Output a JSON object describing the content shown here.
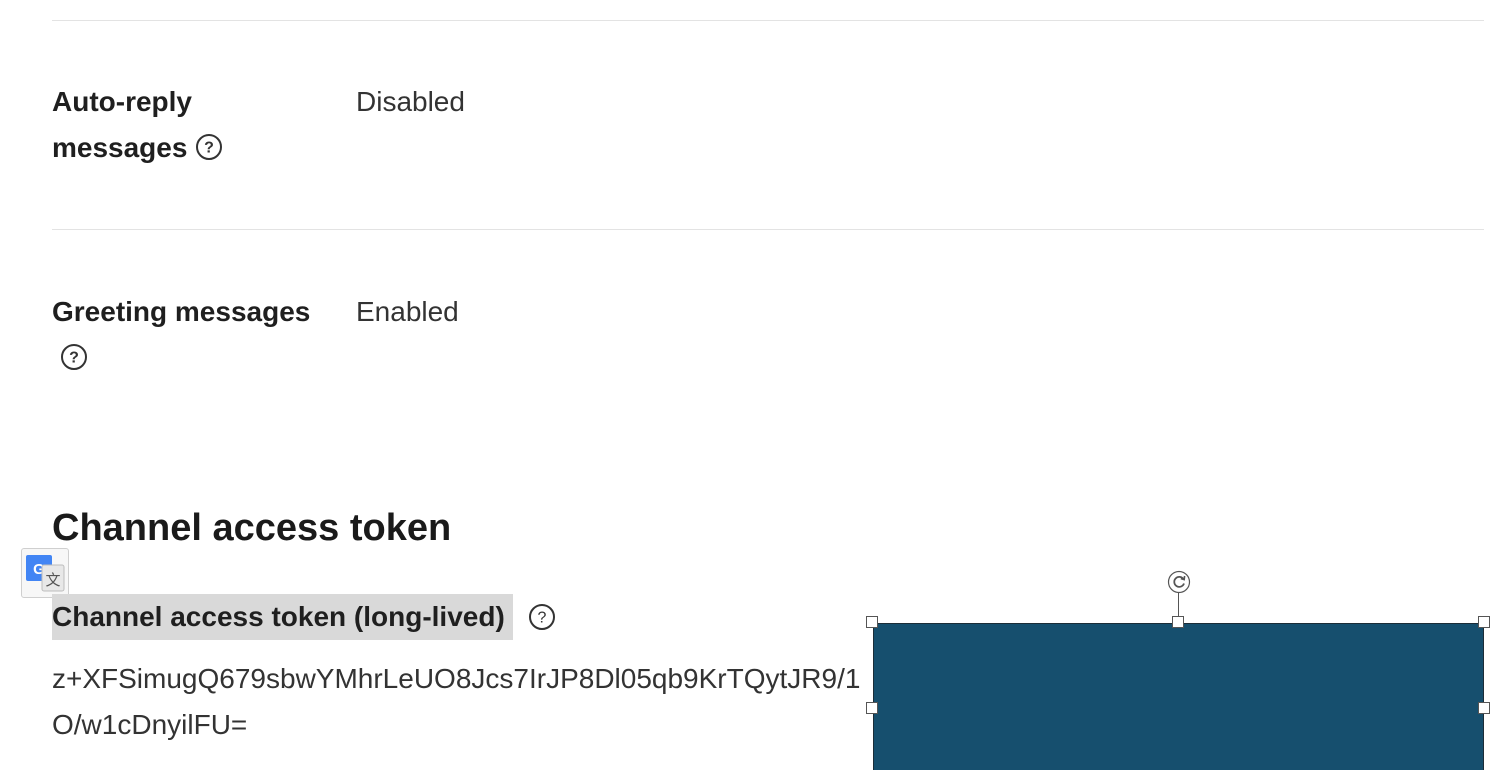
{
  "settings": {
    "auto_reply": {
      "label": "Auto-reply messages",
      "value": "Disabled",
      "help_icon": "help-circle-icon"
    },
    "greeting": {
      "label": "Greeting messages",
      "value": "Enabled",
      "help_icon": "help-circle-icon"
    }
  },
  "channel_access_token": {
    "section_title": "Channel access token",
    "long_lived_label": "Channel access token (long-lived)",
    "help_icon": "help-circle-icon",
    "token_value": "z+XFSimugQ679sbwYMhrLeUO8Jcs7IrJP8Dl05qb9KrTQytJR9/1O/w1cDnyilFU="
  },
  "overlays": {
    "translate_icon": "google-translate-icon",
    "redaction_shape_color": "#164f6e"
  }
}
